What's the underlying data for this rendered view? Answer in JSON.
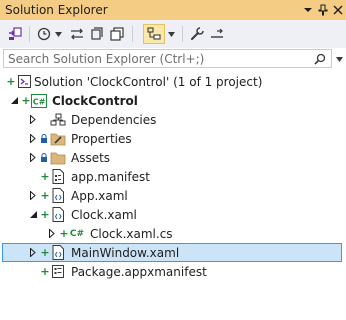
{
  "window": {
    "title": "Solution Explorer",
    "title_bar_color": "#f5cc84"
  },
  "title_buttons": [
    {
      "name": "window-position-icon",
      "glyph": "▾"
    },
    {
      "name": "pin-icon",
      "glyph": "⊣"
    },
    {
      "name": "close-icon",
      "glyph": "✕"
    }
  ],
  "search": {
    "placeholder": "Search Solution Explorer (Ctrl+;)",
    "value": ""
  },
  "tree": {
    "solution_label": "Solution 'ClockControl' (1 of 1 project)",
    "project_label": "ClockControl",
    "items": [
      {
        "label": "Dependencies"
      },
      {
        "label": "Properties"
      },
      {
        "label": "Assets"
      },
      {
        "label": "app.manifest"
      },
      {
        "label": "App.xaml"
      },
      {
        "label": "Clock.xaml"
      },
      {
        "label": "Clock.xaml.cs"
      },
      {
        "label": "MainWindow.xaml"
      },
      {
        "label": "Package.appxmanifest"
      }
    ],
    "cs_badge": "C#",
    "project_badge": "C#"
  },
  "colors": {
    "accent_green": "#1f8a3b",
    "selection_fill": "#cce4f7",
    "selection_border": "#3399ff",
    "folder": "#dcb67a"
  }
}
